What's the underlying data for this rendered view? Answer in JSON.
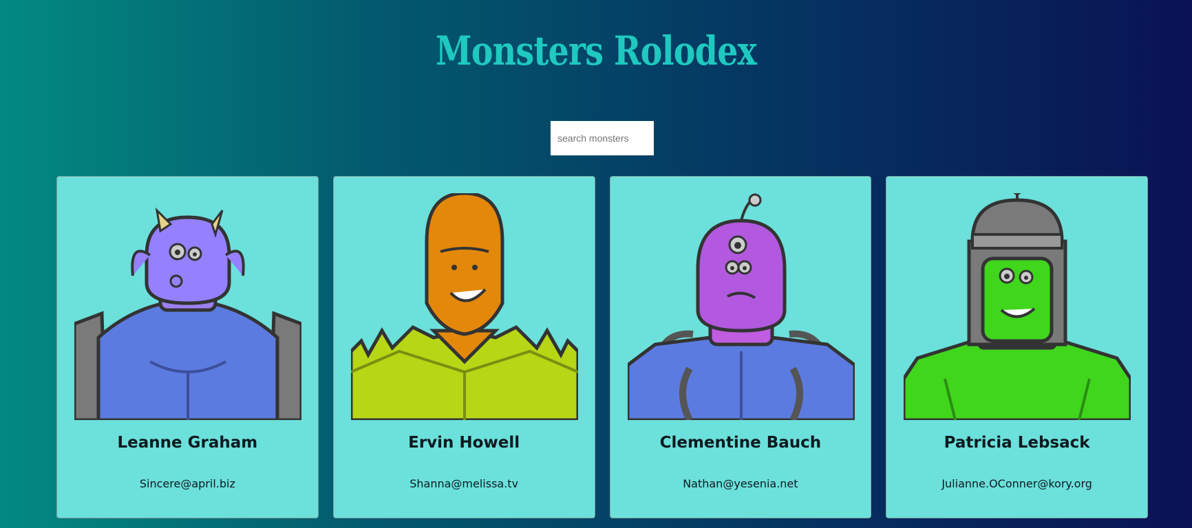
{
  "header": {
    "title": "Monsters Rolodex"
  },
  "search": {
    "placeholder": "search monsters",
    "value": ""
  },
  "monsters": [
    {
      "name": "Leanne Graham",
      "email": "Sincere@april.biz",
      "avatar": "purple-horned-monster-icon"
    },
    {
      "name": "Ervin Howell",
      "email": "Shanna@melissa.tv",
      "avatar": "orange-spiky-monster-icon"
    },
    {
      "name": "Clementine Bauch",
      "email": "Nathan@yesenia.net",
      "avatar": "purple-cyclops-robot-monster-icon"
    },
    {
      "name": "Patricia Lebsack",
      "email": "Julianne.OConner@kory.org",
      "avatar": "green-helmet-robot-monster-icon"
    }
  ],
  "colors": {
    "background_start": "#038a82",
    "background_end": "#0a1254",
    "title": "#1fc9bf",
    "card": "#6ce0db"
  }
}
